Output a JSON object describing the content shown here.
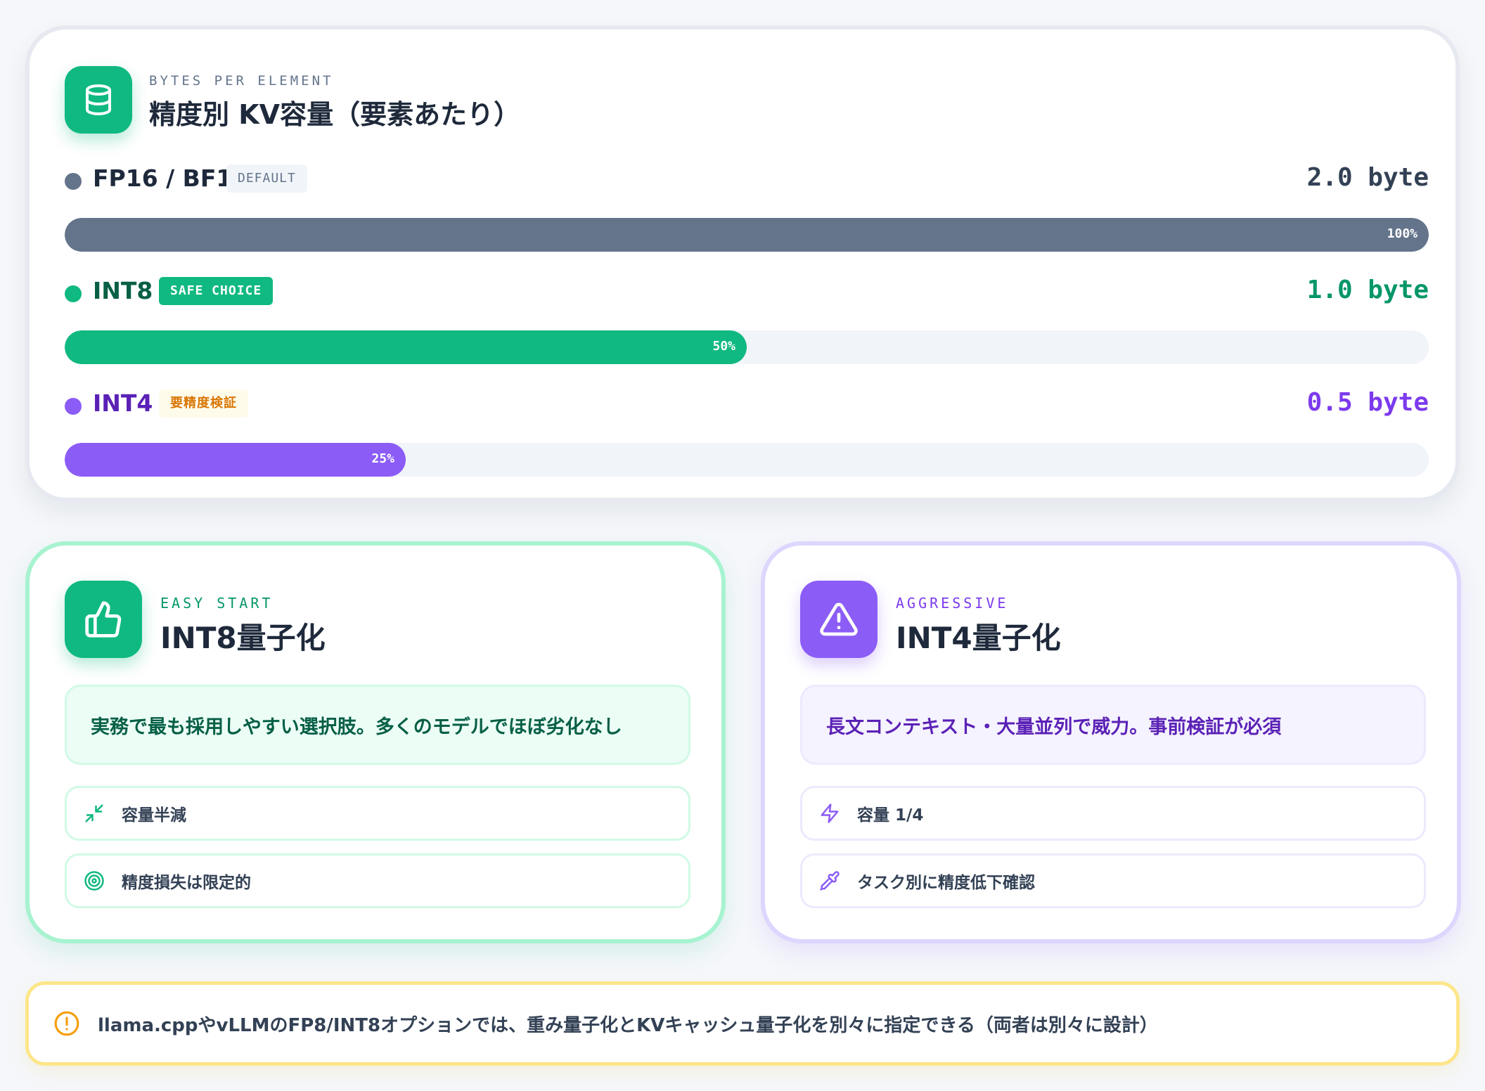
{
  "kv_card": {
    "eyebrow": "BYTES PER ELEMENT",
    "title": "精度別 KV容量（要素あたり）",
    "icon": "database-icon",
    "rows": [
      {
        "name": "FP16 / BF16",
        "badge": "DEFAULT",
        "value": "2.0 byte",
        "percent_label": "100%",
        "fraction": 1.0,
        "color": "#64748b"
      },
      {
        "name": "INT8",
        "badge": "SAFE CHOICE",
        "value": "1.0 byte",
        "percent_label": "50%",
        "fraction": 0.5,
        "color": "#10b981"
      },
      {
        "name": "INT4",
        "badge": "要精度検証",
        "value": "0.5 byte",
        "percent_label": "25%",
        "fraction": 0.25,
        "color": "#8b5cf6"
      }
    ]
  },
  "int8_card": {
    "eyebrow": "EASY START",
    "title": "INT8量子化",
    "icon": "thumbs-up-icon",
    "description": "実務で最も採用しやすい選択肢。多くのモデルでほぼ劣化なし",
    "features": [
      {
        "icon": "minimize-arrows-icon",
        "label": "容量半減"
      },
      {
        "icon": "target-icon",
        "label": "精度損失は限定的"
      }
    ]
  },
  "int4_card": {
    "eyebrow": "AGGRESSIVE",
    "title": "INT4量子化",
    "icon": "warning-triangle-icon",
    "description": "長文コンテキスト・大量並列で威力。事前検証が必須",
    "features": [
      {
        "icon": "lightning-icon",
        "label": "容量 1/4"
      },
      {
        "icon": "pipette-icon",
        "label": "タスク別に精度低下確認"
      }
    ]
  },
  "note": {
    "icon": "alert-circle-icon",
    "text": "llama.cppやvLLMのFP8/INT8オプションでは、重み量子化とKVキャッシュ量子化を別々に指定できる（両者は別々に設計）"
  },
  "colors": {
    "green": "#10b981",
    "purple": "#8b5cf6",
    "slate": "#64748b",
    "amber": "#f59e0b"
  }
}
